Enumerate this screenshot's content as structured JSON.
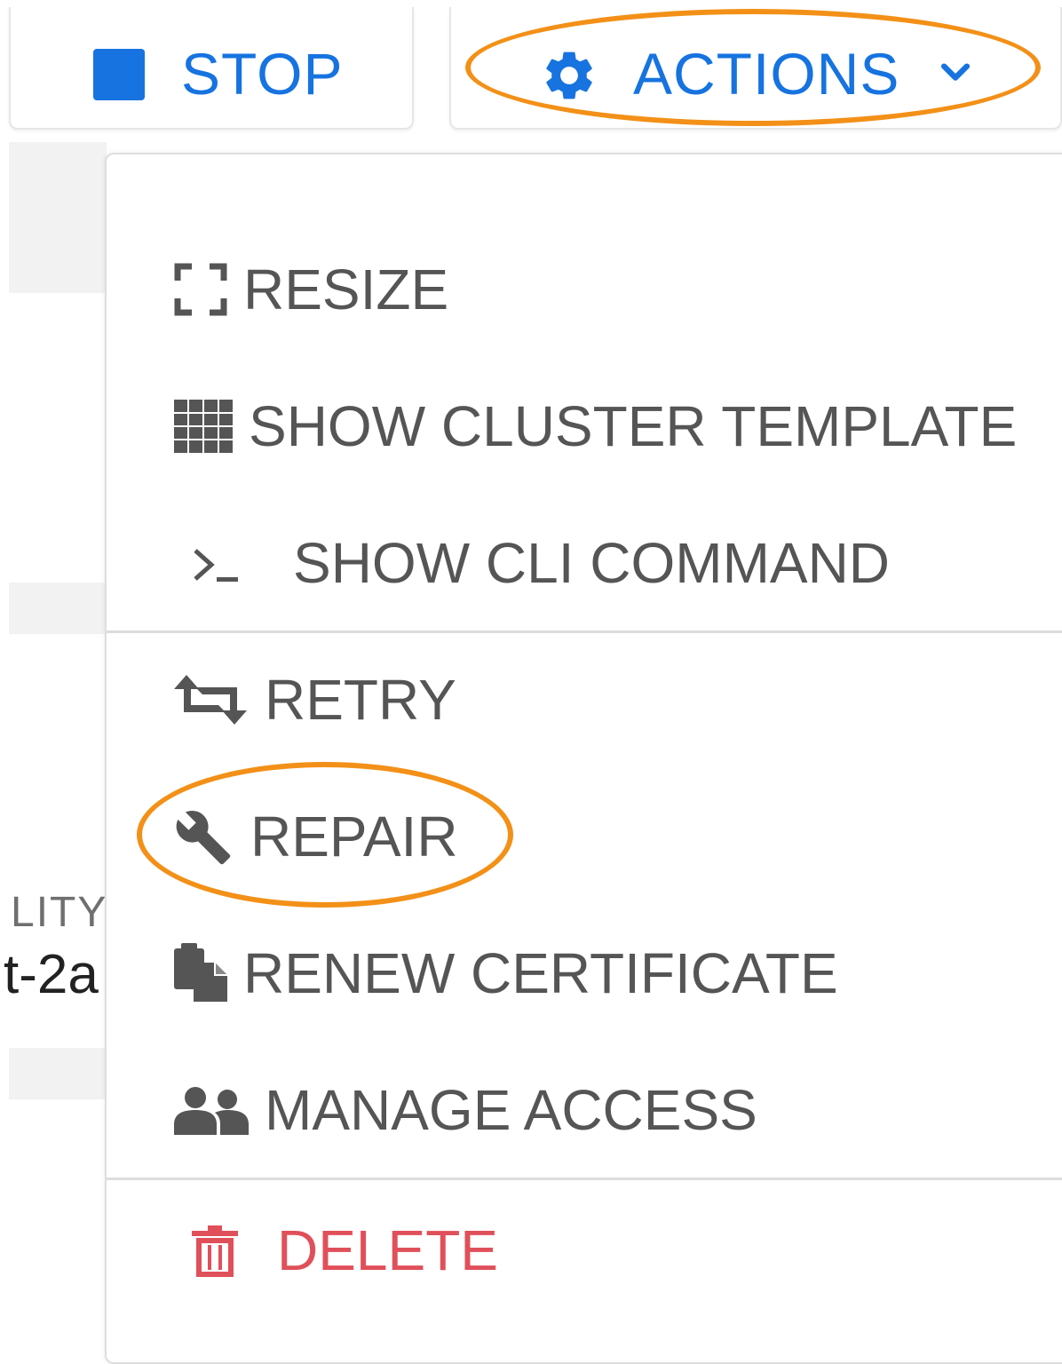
{
  "toolbar": {
    "stop_label": "STOP",
    "actions_label": "ACTIONS"
  },
  "menu": {
    "items": [
      {
        "label": "RESIZE",
        "icon": "resize-icon"
      },
      {
        "label": "SHOW CLUSTER TEMPLATE",
        "icon": "grid-icon"
      },
      {
        "label": "SHOW CLI COMMAND",
        "icon": "terminal-icon"
      },
      {
        "label": "RETRY",
        "icon": "retry-icon"
      },
      {
        "label": "REPAIR",
        "icon": "wrench-icon"
      },
      {
        "label": "RENEW CERTIFICATE",
        "icon": "clipboard-icon"
      },
      {
        "label": "MANAGE ACCESS",
        "icon": "users-icon"
      },
      {
        "label": "DELETE",
        "icon": "trash-icon"
      }
    ]
  },
  "background": {
    "column_fragment": "LITY",
    "value_fragment": "t-2a"
  },
  "colors": {
    "accent": "#1673e0",
    "annotation": "#f39017",
    "danger": "#e0505a",
    "menu_text": "#555555"
  }
}
